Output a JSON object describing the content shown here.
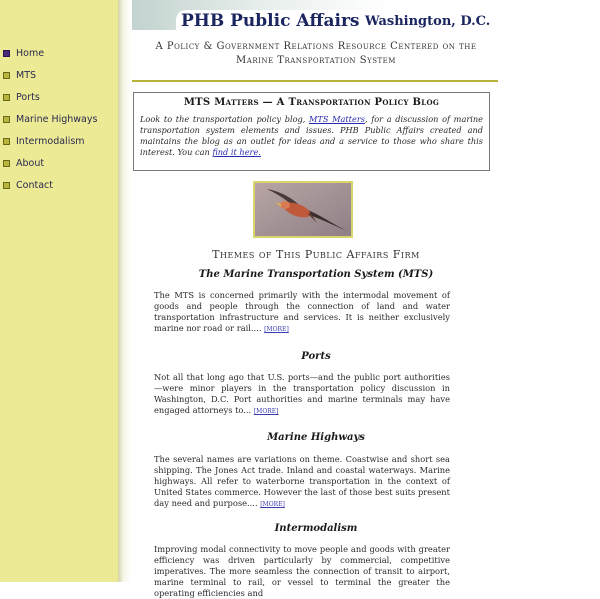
{
  "header": {
    "title": "PHB Public Affairs",
    "city": "Washington, D.C.",
    "tagline_line1": "A Policy & Government Relations Resource Centered on the",
    "tagline_line2": "Marine Transportation System"
  },
  "sidebar": {
    "items": [
      {
        "label": "Home"
      },
      {
        "label": "MTS"
      },
      {
        "label": "Ports"
      },
      {
        "label": "Marine Highways"
      },
      {
        "label": "Intermodalism"
      },
      {
        "label": "About"
      },
      {
        "label": "Contact"
      }
    ]
  },
  "blog": {
    "title": "MTS Matters — A Transportation Policy Blog",
    "text_a": "Look to the transportation policy blog, ",
    "link_text": "MTS Matters",
    "text_b": ", for a discussion of marine transportation system elements and issues.  PHB Public Affairs created and maintains the blog as an outlet for ideas and a service to those who share this interest.  You can ",
    "find_link": "find it here."
  },
  "themes_heading": "Themes of This Public Affairs Firm",
  "sections": [
    {
      "heading": "The Marine Transportation System (MTS)",
      "body": "The MTS is concerned primarily with the intermodal movement of goods and people through the connection of land and water transportation infrastructure and services.  It is neither exclusively marine nor road or rail.... ",
      "more": "[MORE]"
    },
    {
      "heading": "Ports",
      "body": "Not all that long ago that U.S. ports—and the public port authorities—were minor players in the transportation policy discussion in Washington, D.C.  Port authorities and marine terminals may have engaged attorneys to... ",
      "more": "[MORE]"
    },
    {
      "heading": "Marine Highways",
      "body": "The several names are variations on theme.  Coastwise and short sea shipping.  The Jones Act trade.  Inland  and coastal waterways.  Marine highways.  All refer to waterborne transportation in the context of United States commerce.  However the last of those best suits present day need and purpose.... ",
      "more": "[MORE]"
    },
    {
      "heading": "Intermodalism",
      "body": "Improving modal connectivity to move people and goods with greater efficiency was driven particularly by commercial, competitive imperatives.  The more seamless the connection of transit to airport, marine terminal to rail, or vessel to terminal the greater the operating efficiencies and",
      "more": ""
    }
  ],
  "colors": {
    "sidebar_bg": "#ecea94",
    "accent_gold": "#b7b33a",
    "title_navy": "#1b2560",
    "link": "#2a2ab0"
  },
  "icons": {
    "bullet": "square-bullet-icon",
    "photo": "bird-in-flight-photo"
  }
}
